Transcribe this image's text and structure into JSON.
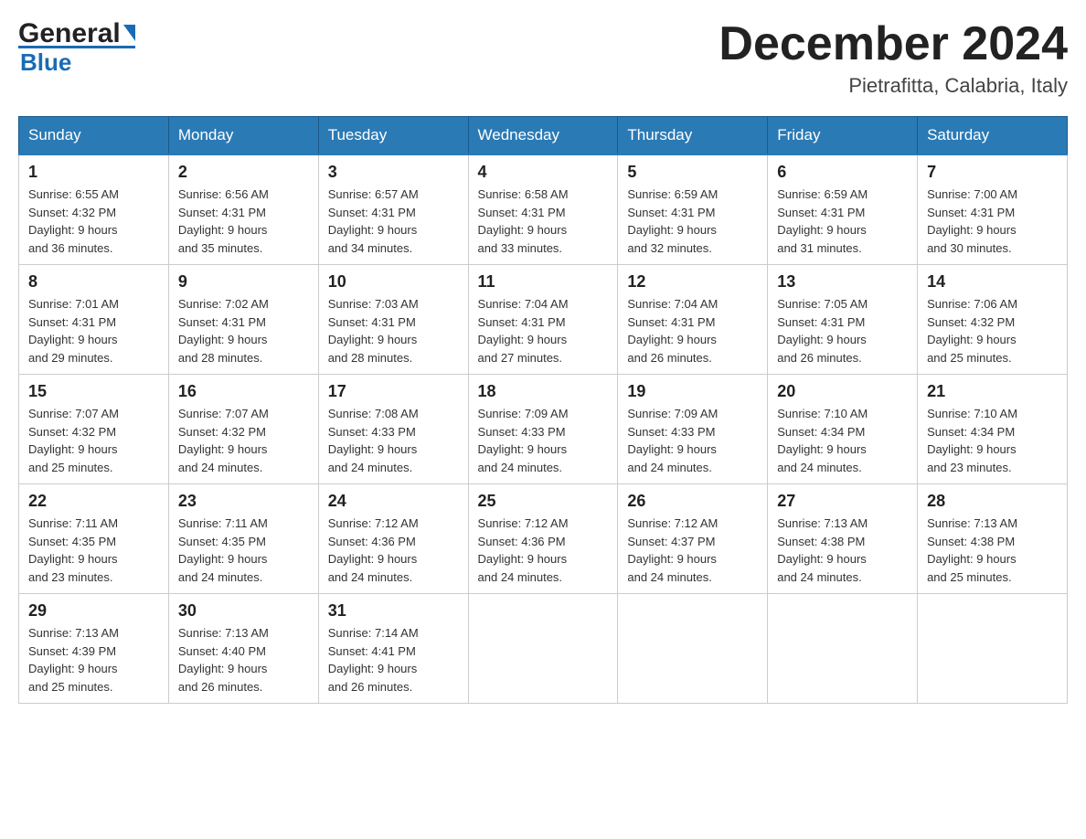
{
  "logo": {
    "general": "General",
    "blue": "Blue"
  },
  "title": "December 2024",
  "subtitle": "Pietrafitta, Calabria, Italy",
  "days_of_week": [
    "Sunday",
    "Monday",
    "Tuesday",
    "Wednesday",
    "Thursday",
    "Friday",
    "Saturday"
  ],
  "weeks": [
    [
      {
        "day": "1",
        "sunrise": "6:55 AM",
        "sunset": "4:32 PM",
        "daylight": "9 hours and 36 minutes."
      },
      {
        "day": "2",
        "sunrise": "6:56 AM",
        "sunset": "4:31 PM",
        "daylight": "9 hours and 35 minutes."
      },
      {
        "day": "3",
        "sunrise": "6:57 AM",
        "sunset": "4:31 PM",
        "daylight": "9 hours and 34 minutes."
      },
      {
        "day": "4",
        "sunrise": "6:58 AM",
        "sunset": "4:31 PM",
        "daylight": "9 hours and 33 minutes."
      },
      {
        "day": "5",
        "sunrise": "6:59 AM",
        "sunset": "4:31 PM",
        "daylight": "9 hours and 32 minutes."
      },
      {
        "day": "6",
        "sunrise": "6:59 AM",
        "sunset": "4:31 PM",
        "daylight": "9 hours and 31 minutes."
      },
      {
        "day": "7",
        "sunrise": "7:00 AM",
        "sunset": "4:31 PM",
        "daylight": "9 hours and 30 minutes."
      }
    ],
    [
      {
        "day": "8",
        "sunrise": "7:01 AM",
        "sunset": "4:31 PM",
        "daylight": "9 hours and 29 minutes."
      },
      {
        "day": "9",
        "sunrise": "7:02 AM",
        "sunset": "4:31 PM",
        "daylight": "9 hours and 28 minutes."
      },
      {
        "day": "10",
        "sunrise": "7:03 AM",
        "sunset": "4:31 PM",
        "daylight": "9 hours and 28 minutes."
      },
      {
        "day": "11",
        "sunrise": "7:04 AM",
        "sunset": "4:31 PM",
        "daylight": "9 hours and 27 minutes."
      },
      {
        "day": "12",
        "sunrise": "7:04 AM",
        "sunset": "4:31 PM",
        "daylight": "9 hours and 26 minutes."
      },
      {
        "day": "13",
        "sunrise": "7:05 AM",
        "sunset": "4:31 PM",
        "daylight": "9 hours and 26 minutes."
      },
      {
        "day": "14",
        "sunrise": "7:06 AM",
        "sunset": "4:32 PM",
        "daylight": "9 hours and 25 minutes."
      }
    ],
    [
      {
        "day": "15",
        "sunrise": "7:07 AM",
        "sunset": "4:32 PM",
        "daylight": "9 hours and 25 minutes."
      },
      {
        "day": "16",
        "sunrise": "7:07 AM",
        "sunset": "4:32 PM",
        "daylight": "9 hours and 24 minutes."
      },
      {
        "day": "17",
        "sunrise": "7:08 AM",
        "sunset": "4:33 PM",
        "daylight": "9 hours and 24 minutes."
      },
      {
        "day": "18",
        "sunrise": "7:09 AM",
        "sunset": "4:33 PM",
        "daylight": "9 hours and 24 minutes."
      },
      {
        "day": "19",
        "sunrise": "7:09 AM",
        "sunset": "4:33 PM",
        "daylight": "9 hours and 24 minutes."
      },
      {
        "day": "20",
        "sunrise": "7:10 AM",
        "sunset": "4:34 PM",
        "daylight": "9 hours and 24 minutes."
      },
      {
        "day": "21",
        "sunrise": "7:10 AM",
        "sunset": "4:34 PM",
        "daylight": "9 hours and 23 minutes."
      }
    ],
    [
      {
        "day": "22",
        "sunrise": "7:11 AM",
        "sunset": "4:35 PM",
        "daylight": "9 hours and 23 minutes."
      },
      {
        "day": "23",
        "sunrise": "7:11 AM",
        "sunset": "4:35 PM",
        "daylight": "9 hours and 24 minutes."
      },
      {
        "day": "24",
        "sunrise": "7:12 AM",
        "sunset": "4:36 PM",
        "daylight": "9 hours and 24 minutes."
      },
      {
        "day": "25",
        "sunrise": "7:12 AM",
        "sunset": "4:36 PM",
        "daylight": "9 hours and 24 minutes."
      },
      {
        "day": "26",
        "sunrise": "7:12 AM",
        "sunset": "4:37 PM",
        "daylight": "9 hours and 24 minutes."
      },
      {
        "day": "27",
        "sunrise": "7:13 AM",
        "sunset": "4:38 PM",
        "daylight": "9 hours and 24 minutes."
      },
      {
        "day": "28",
        "sunrise": "7:13 AM",
        "sunset": "4:38 PM",
        "daylight": "9 hours and 25 minutes."
      }
    ],
    [
      {
        "day": "29",
        "sunrise": "7:13 AM",
        "sunset": "4:39 PM",
        "daylight": "9 hours and 25 minutes."
      },
      {
        "day": "30",
        "sunrise": "7:13 AM",
        "sunset": "4:40 PM",
        "daylight": "9 hours and 26 minutes."
      },
      {
        "day": "31",
        "sunrise": "7:14 AM",
        "sunset": "4:41 PM",
        "daylight": "9 hours and 26 minutes."
      },
      null,
      null,
      null,
      null
    ]
  ],
  "labels": {
    "sunrise": "Sunrise:",
    "sunset": "Sunset:",
    "daylight": "Daylight:"
  }
}
